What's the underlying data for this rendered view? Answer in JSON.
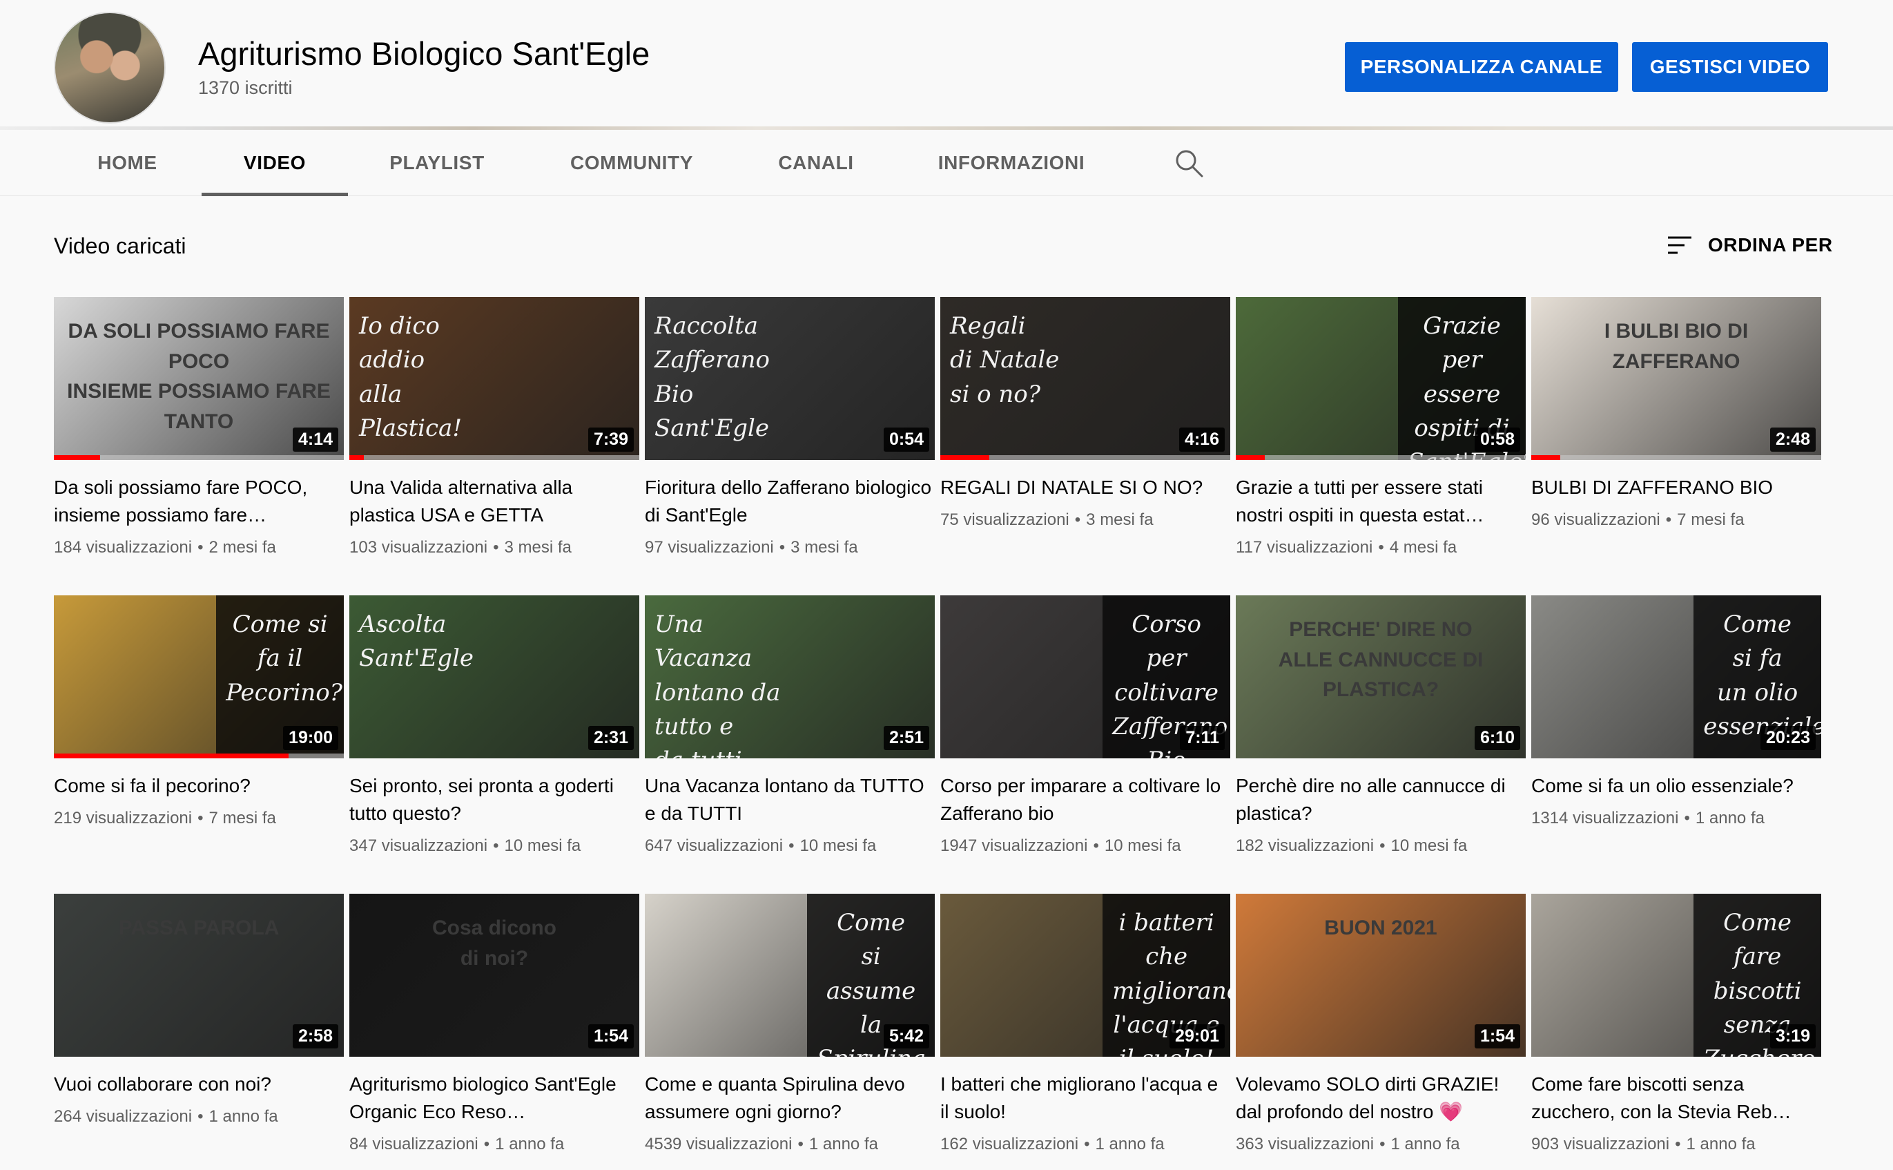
{
  "channel": {
    "name": "Agriturismo Biologico Sant'Egle",
    "subscribers": "1370 iscritti",
    "customize_label": "PERSONALIZZA CANALE",
    "manage_label": "GESTISCI VIDEO"
  },
  "tabs": [
    {
      "label": "HOME"
    },
    {
      "label": "VIDEO"
    },
    {
      "label": "PLAYLIST"
    },
    {
      "label": "COMMUNITY"
    },
    {
      "label": "CANALI"
    },
    {
      "label": "INFORMAZIONI"
    }
  ],
  "active_tab": "VIDEO",
  "section": {
    "title": "Video caricati",
    "sort_label": "ORDINA PER"
  },
  "colors": {
    "accent": "#065fd4",
    "progress": "#ff0000",
    "background": "#f9f9f9"
  },
  "videos": [
    {
      "title": "Da soli possiamo fare POCO, insieme possiamo fare…",
      "views": "184 visualizzazioni",
      "age": "2 mesi fa",
      "duration": "4:14",
      "progress": 0.16,
      "thumb_text": "DA SOLI POSSIAMO FARE\nPOCO\nINSIEME POSSIAMO FARE\nTANTO",
      "thumb_bg": "#d8d8d8"
    },
    {
      "title": "Una Valida alternativa alla plastica USA e GETTA",
      "views": "103 visualizzazioni",
      "age": "3 mesi fa",
      "duration": "7:39",
      "progress": 0.05,
      "thumb_text": "Io dico\naddio\nalla\nPlastica!",
      "thumb_bg": "#5b3a22"
    },
    {
      "title": "Fioritura dello Zafferano biologico di Sant'Egle",
      "views": "97 visualizzazioni",
      "age": "3 mesi fa",
      "duration": "0:54",
      "progress": 0.0,
      "thumb_text": "Raccolta\nZafferano\nBio Sant'Egle",
      "thumb_bg": "#3a3a3a"
    },
    {
      "title": "REGALI DI NATALE SI O NO?",
      "views": "75 visualizzazioni",
      "age": "3 mesi fa",
      "duration": "4:16",
      "progress": 0.17,
      "thumb_text": "Regali\ndi Natale\nsi o no?",
      "thumb_bg": "#2e2a26"
    },
    {
      "title": "Grazie a tutti per essere stati nostri ospiti in questa estat…",
      "views": "117 visualizzazioni",
      "age": "4 mesi fa",
      "duration": "0:58",
      "progress": 0.1,
      "thumb_text": "Grazie\nper essere\nospiti di\nSant'Egle♡",
      "thumb_bg": "#4d6a3a"
    },
    {
      "title": "BULBI DI ZAFFERANO BIO",
      "views": "96 visualizzazioni",
      "age": "7 mesi fa",
      "duration": "2:48",
      "progress": 0.1,
      "thumb_text": "I BULBI BIO DI ZAFFERANO",
      "thumb_bg": "#e6dfd6"
    },
    {
      "title": "Come si fa il pecorino?",
      "views": "219 visualizzazioni",
      "age": "7 mesi fa",
      "duration": "19:00",
      "progress": 0.81,
      "thumb_text": "Come si\nfa il\nPecorino?",
      "thumb_bg": "#c79a3a"
    },
    {
      "title": "Sei pronto, sei pronta a goderti tutto questo?",
      "views": "347 visualizzazioni",
      "age": "10 mesi fa",
      "duration": "2:31",
      "progress": 0.0,
      "thumb_text": "Ascolta\nSant'Egle",
      "thumb_bg": "#3c5a34"
    },
    {
      "title": "Una Vacanza lontano da TUTTO e da TUTTI",
      "views": "647 visualizzazioni",
      "age": "10 mesi fa",
      "duration": "2:51",
      "progress": 0.0,
      "thumb_text": "Una\nVacanza\nlontano da\ntutto e\nda tutti",
      "thumb_bg": "#4a6a3e"
    },
    {
      "title": "Corso per imparare a coltivare lo Zafferano bio",
      "views": "1947 visualizzazioni",
      "age": "10 mesi fa",
      "duration": "7:11",
      "progress": 0.0,
      "thumb_text": "Corso per\ncoltivare\nZafferano\nBio",
      "thumb_bg": "#3d3a3a"
    },
    {
      "title": "Perchè dire no alle cannucce di plastica?",
      "views": "182 visualizzazioni",
      "age": "10 mesi fa",
      "duration": "6:10",
      "progress": 0.0,
      "thumb_text": "PERCHE' DIRE NO\nALLE CANNUCCE DI PLASTICA?",
      "thumb_bg": "#6b7a58"
    },
    {
      "title": "Come si fa un olio essenziale?",
      "views": "1314 visualizzazioni",
      "age": "1 anno fa",
      "duration": "20:23",
      "progress": 0.0,
      "thumb_text": "Come\nsi fa\nun olio\nessenziale",
      "thumb_bg": "#8a8a86"
    },
    {
      "title": "Vuoi collaborare con noi?",
      "views": "264 visualizzazioni",
      "age": "1 anno fa",
      "duration": "2:58",
      "progress": 0.0,
      "thumb_text": "PASSA PAROLA",
      "thumb_bg": "#3b3f3d"
    },
    {
      "title": "Agriturismo biologico Sant'Egle Organic Eco Reso…",
      "views": "84 visualizzazioni",
      "age": "1 anno fa",
      "duration": "1:54",
      "progress": 0.0,
      "thumb_text": "Cosa dicono\ndi noi?",
      "thumb_bg": "#151515"
    },
    {
      "title": "Come e quanta Spirulina devo assumere ogni giorno?",
      "views": "4539 visualizzazioni",
      "age": "1 anno fa",
      "duration": "5:42",
      "progress": 0.0,
      "thumb_text": "Come\nsi assume\nla\nSpirulina",
      "thumb_bg": "#d6d2ca"
    },
    {
      "title": "I batteri che migliorano l'acqua e il suolo!",
      "views": "162 visualizzazioni",
      "age": "1 anno fa",
      "duration": "29:01",
      "progress": 0.0,
      "thumb_text": "i batteri che\nmigliorano\nl'acqua e\nil suolo!",
      "thumb_bg": "#6a5a3c"
    },
    {
      "title": "Volevamo SOLO dirti GRAZIE! dal profondo del nostro 💗",
      "views": "363 visualizzazioni",
      "age": "1 anno fa",
      "duration": "1:54",
      "progress": 0.0,
      "thumb_text": "BUON 2021",
      "thumb_bg": "#d07a3a"
    },
    {
      "title": "Come fare biscotti senza zucchero, con la Stevia Reb…",
      "views": "903 visualizzazioni",
      "age": "1 anno fa",
      "duration": "3:19",
      "progress": 0.0,
      "thumb_text": "Come fare\nbiscotti\nsenza\nZucchero",
      "thumb_bg": "#aaa59c"
    }
  ]
}
